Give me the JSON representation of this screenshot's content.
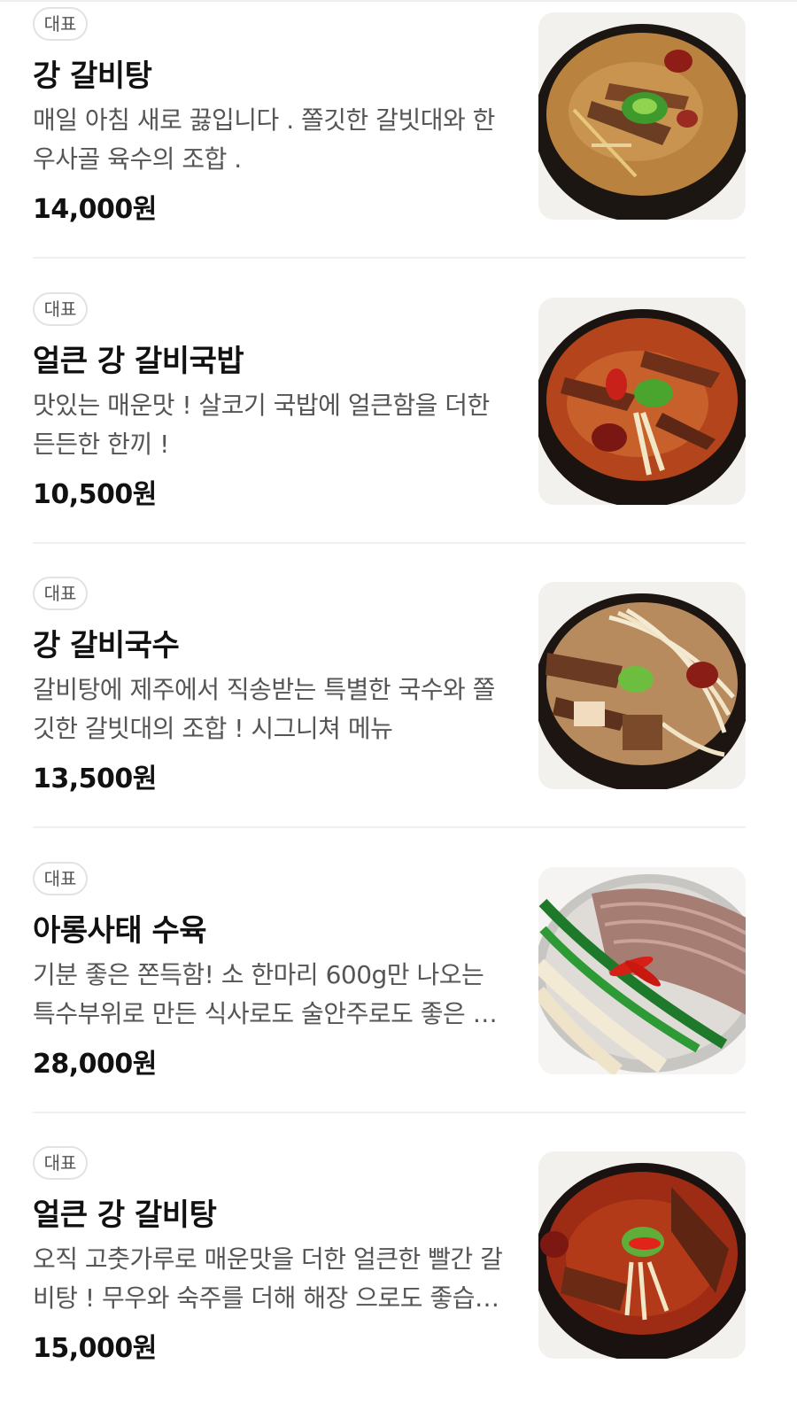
{
  "menu": {
    "items": [
      {
        "badge": "대표",
        "name": "강 갈비탕",
        "description": "매일 아침 새로 끓입니다 . 쫄깃한 갈빗대와 한우사골 육수의 조합 .",
        "price": "14,000원",
        "image": "clear-galbitang-bowl-photo"
      },
      {
        "badge": "대표",
        "name": "얼큰 강 갈비국밥",
        "description": "맛있는 매운맛 ! 살코기 국밥에 얼큰함을 더한 든든한 한끼 !",
        "price": "10,500원",
        "image": "spicy-galbi-gukbap-bowl-photo"
      },
      {
        "badge": "대표",
        "name": "강 갈비국수",
        "description": "갈비탕에 제주에서 직송받는 특별한 국수와 쫄깃한 갈빗대의 조합 ! 시그니쳐 메뉴",
        "price": "13,500원",
        "image": "galbi-noodle-bowl-photo"
      },
      {
        "badge": "대표",
        "name": "아롱사태 수육",
        "description": "기분 좋은 쫀득함! 소 한마리 600g만 나오는 특수부위로 만든 식사로도 술안주로도 좋은 메뉴",
        "price": "28,000원",
        "image": "sliced-beef-suyuk-platter-photo"
      },
      {
        "badge": "대표",
        "name": "얼큰 강 갈비탕",
        "description": "오직 고춧가루로 매운맛을 더한 얼큰한 빨간 갈비탕 ! 무우와 숙주를 더해 해장 으로도 좋습니다",
        "price": "15,000원",
        "image": "spicy-red-galbitang-bowl-photo"
      }
    ]
  }
}
